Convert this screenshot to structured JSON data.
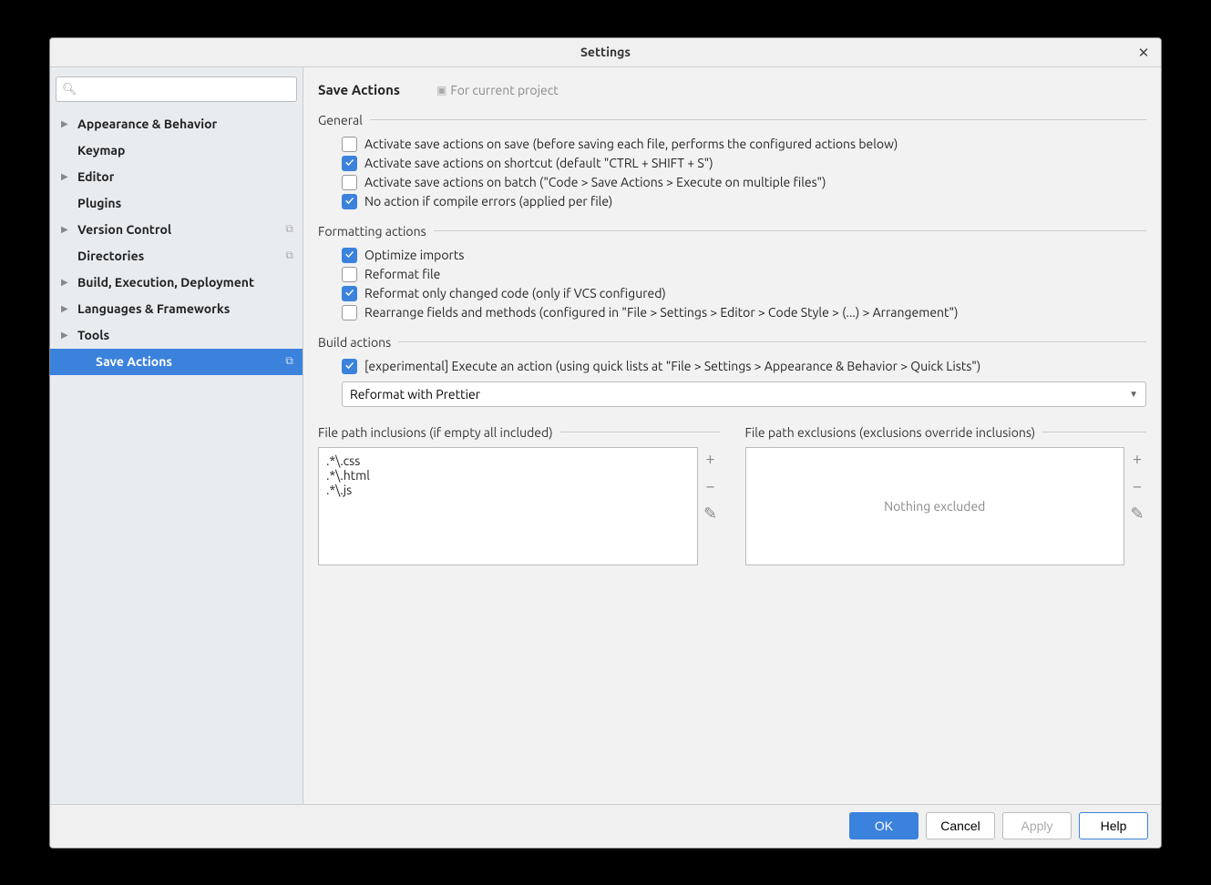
{
  "window": {
    "title": "Settings"
  },
  "search": {
    "placeholder": ""
  },
  "sidebar": {
    "items": [
      {
        "label": "Appearance & Behavior",
        "expandable": true
      },
      {
        "label": "Keymap",
        "expandable": false
      },
      {
        "label": "Editor",
        "expandable": true
      },
      {
        "label": "Plugins",
        "expandable": false
      },
      {
        "label": "Version Control",
        "expandable": true,
        "badge": "⧉"
      },
      {
        "label": "Directories",
        "expandable": false,
        "badge": "⧉"
      },
      {
        "label": "Build, Execution, Deployment",
        "expandable": true
      },
      {
        "label": "Languages & Frameworks",
        "expandable": true
      },
      {
        "label": "Tools",
        "expandable": true
      },
      {
        "label": "Save Actions",
        "expandable": false,
        "selected": true,
        "badge": "⧉",
        "indent": true
      }
    ]
  },
  "main": {
    "title": "Save Actions",
    "scope": "For current project"
  },
  "general": {
    "title": "General",
    "opts": [
      {
        "label": "Activate save actions on save (before saving each file, performs the configured actions below)",
        "checked": false
      },
      {
        "label": "Activate save actions on shortcut (default \"CTRL + SHIFT + S\")",
        "checked": true
      },
      {
        "label": "Activate save actions on batch (\"Code > Save Actions > Execute on multiple files\")",
        "checked": false
      },
      {
        "label": "No action if compile errors (applied per file)",
        "checked": true
      }
    ]
  },
  "formatting": {
    "title": "Formatting actions",
    "opts": [
      {
        "label": "Optimize imports",
        "checked": true
      },
      {
        "label": "Reformat file",
        "checked": false
      },
      {
        "label": "Reformat only changed code (only if VCS configured)",
        "checked": true
      },
      {
        "label": "Rearrange fields and methods (configured in \"File > Settings > Editor > Code Style > (...) > Arrangement\")",
        "checked": false
      }
    ]
  },
  "build": {
    "title": "Build actions",
    "opt": {
      "label": "[experimental] Execute an action (using quick lists at \"File > Settings > Appearance & Behavior > Quick Lists\")",
      "checked": true
    },
    "select_value": "Reformat with Prettier"
  },
  "inclusions": {
    "title": "File path inclusions (if empty all included)",
    "items": [
      ".*\\.css",
      ".*\\.html",
      ".*\\.js"
    ]
  },
  "exclusions": {
    "title": "File path exclusions (exclusions override inclusions)",
    "empty": "Nothing excluded"
  },
  "footer": {
    "ok": "OK",
    "cancel": "Cancel",
    "apply": "Apply",
    "help": "Help"
  }
}
